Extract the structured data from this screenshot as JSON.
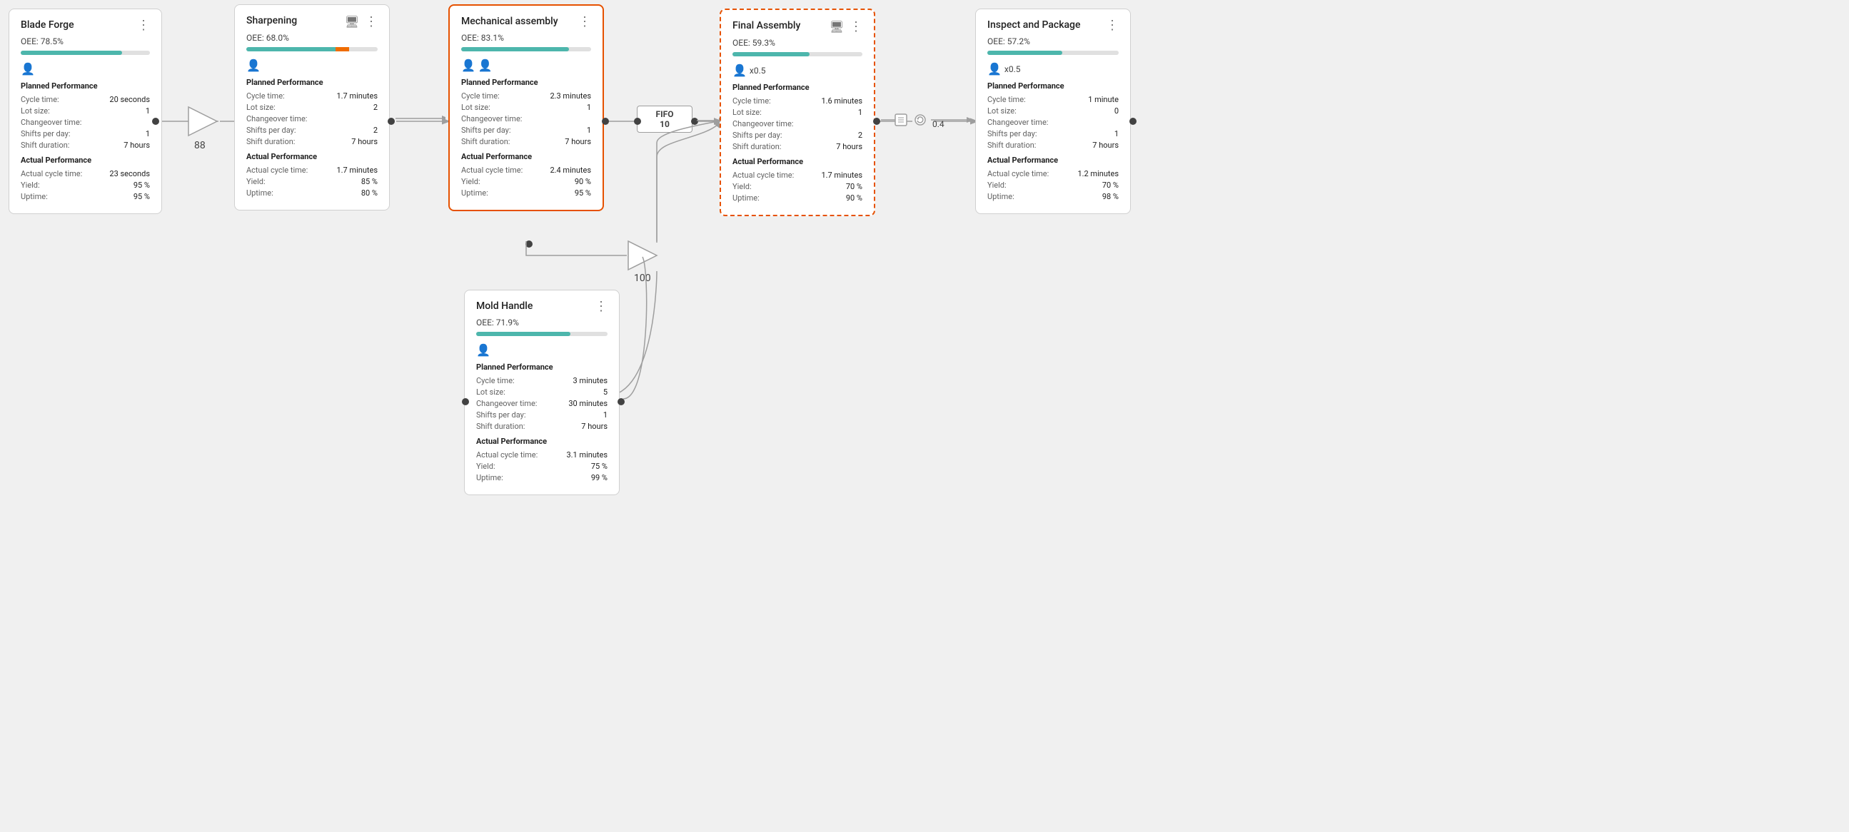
{
  "stations": {
    "blade_forge": {
      "title": "Blade Forge",
      "oee": "OEE: 78.5%",
      "oee_pct": 78.5,
      "bar_color": "teal",
      "workers": "1",
      "worker_icon": "person",
      "worker_multiplier": null,
      "planned": {
        "label": "Planned Performance",
        "cycle_time": "20 seconds",
        "lot_size": "1",
        "changeover_time": "",
        "shifts_per_day": "1",
        "shift_duration": "7 hours"
      },
      "actual": {
        "label": "Actual Performance",
        "cycle_time": "23 seconds",
        "yield": "95 %",
        "uptime": "95 %"
      }
    },
    "sharpening": {
      "title": "Sharpening",
      "oee": "OEE: 68.0%",
      "oee_pct": 68.0,
      "bar_teal": 68,
      "bar_orange": 10,
      "has_monitor": true,
      "workers": "1",
      "worker_multiplier": null,
      "planned": {
        "label": "Planned Performance",
        "cycle_time": "1.7 minutes",
        "lot_size": "2",
        "changeover_time": "",
        "shifts_per_day": "2",
        "shift_duration": "7 hours"
      },
      "actual": {
        "label": "Actual Performance",
        "cycle_time": "1.7 minutes",
        "yield": "85 %",
        "uptime": "80 %"
      }
    },
    "mechanical_assembly": {
      "title": "Mechanical assembly",
      "oee": "OEE: 83.1%",
      "oee_pct": 83.1,
      "bar_color": "teal",
      "workers": "2",
      "worker_multiplier": null,
      "highlighted": true,
      "planned": {
        "label": "Planned Performance",
        "cycle_time": "2.3 minutes",
        "lot_size": "1",
        "changeover_time": "",
        "shifts_per_day": "1",
        "shift_duration": "7 hours"
      },
      "actual": {
        "label": "Actual Performance",
        "cycle_time": "2.4 minutes",
        "yield": "90 %",
        "uptime": "95 %"
      }
    },
    "final_assembly": {
      "title": "Final Assembly",
      "oee": "OEE: 59.3%",
      "oee_pct": 59.3,
      "bar_color": "teal",
      "has_monitor": true,
      "workers": "x0.5",
      "worker_multiplier": "x0.5",
      "highlighted_dashed": true,
      "planned": {
        "label": "Planned Performance",
        "cycle_time": "1.6 minutes",
        "lot_size": "1",
        "changeover_time": "",
        "shifts_per_day": "2",
        "shift_duration": "7 hours"
      },
      "actual": {
        "label": "Actual Performance",
        "cycle_time": "1.7 minutes",
        "yield": "70 %",
        "uptime": "90 %"
      }
    },
    "inspect_package": {
      "title": "Inspect and Package",
      "oee": "OEE: 57.2%",
      "oee_pct": 57.2,
      "bar_color": "teal",
      "workers": "x0.5",
      "worker_multiplier": "x0.5",
      "planned": {
        "label": "Planned Performance",
        "cycle_time": "1 minute",
        "lot_size": "0",
        "changeover_time": "",
        "shifts_per_day": "1",
        "shift_duration": "7 hours"
      },
      "actual": {
        "label": "Actual Performance",
        "cycle_time": "1.2 minutes",
        "yield": "70 %",
        "uptime": "98 %"
      }
    },
    "mold_handle": {
      "title": "Mold Handle",
      "oee": "OEE: 71.9%",
      "oee_pct": 71.9,
      "bar_color": "teal",
      "workers": "1",
      "worker_multiplier": null,
      "planned": {
        "label": "Planned Performance",
        "cycle_time": "3 minutes",
        "lot_size": "5",
        "changeover_time": "30 minutes",
        "shifts_per_day": "1",
        "shift_duration": "7 hours"
      },
      "actual": {
        "label": "Actual Performance",
        "cycle_time": "3.1 minutes",
        "yield": "75 %",
        "uptime": "99 %"
      }
    }
  },
  "connectors": {
    "triangle1_label": "88",
    "triangle2_label": "",
    "fifo_label": "FIFO",
    "fifo_value": "10",
    "triangle3_label": "100",
    "bottom_connector_value": "0.4"
  },
  "labels": {
    "planned_performance": "Planned Performance",
    "actual_performance": "Actual Performance",
    "cycle_time": "Cycle time:",
    "lot_size": "Lot size:",
    "changeover_time": "Changeover time:",
    "shifts_per_day": "Shifts per day:",
    "shift_duration": "Shift duration:",
    "actual_cycle_time": "Actual cycle time:",
    "yield": "Yield:",
    "uptime": "Uptime:"
  }
}
